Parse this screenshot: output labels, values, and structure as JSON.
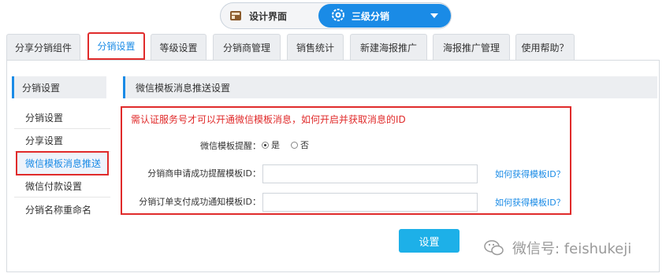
{
  "mode_switch": {
    "left_label": "设计界面",
    "right_label": "三级分销"
  },
  "tabs": [
    {
      "label": "分享分销组件"
    },
    {
      "label": "分销设置",
      "active": true
    },
    {
      "label": "等级设置"
    },
    {
      "label": "分销商管理"
    },
    {
      "label": "销售统计"
    },
    {
      "label": "新建海报推广"
    },
    {
      "label": "海报推广管理"
    },
    {
      "label": "使用帮助？"
    }
  ],
  "sidebar": {
    "header": "分销设置",
    "items": [
      {
        "label": "分销设置"
      },
      {
        "label": "分享设置"
      },
      {
        "label": "微信模板消息推送",
        "active": true
      },
      {
        "label": "微信付款设置"
      },
      {
        "label": "分销名称重命名"
      }
    ]
  },
  "main": {
    "section_title": "微信模板消息推送设置",
    "notice": "需认证服务号才可以开通微信模板消息，如何开启并获取消息的ID",
    "reminder": {
      "label": "微信模板提醒：",
      "options": [
        {
          "label": "是",
          "checked": true
        },
        {
          "label": "否",
          "checked": false
        }
      ]
    },
    "field1": {
      "label": "分销商申请成功提醒模板ID：",
      "value": "",
      "help_link": "如何获得模板ID？"
    },
    "field2": {
      "label": "分销订单支付成功通知模板ID：",
      "value": "",
      "help_link": "如何获得模板ID？"
    },
    "submit_label": "设置"
  },
  "watermark": "微信号: feishukeji",
  "colors": {
    "accent": "#1a8be6",
    "highlight_border": "#e02b2b",
    "button": "#1db0e8"
  }
}
